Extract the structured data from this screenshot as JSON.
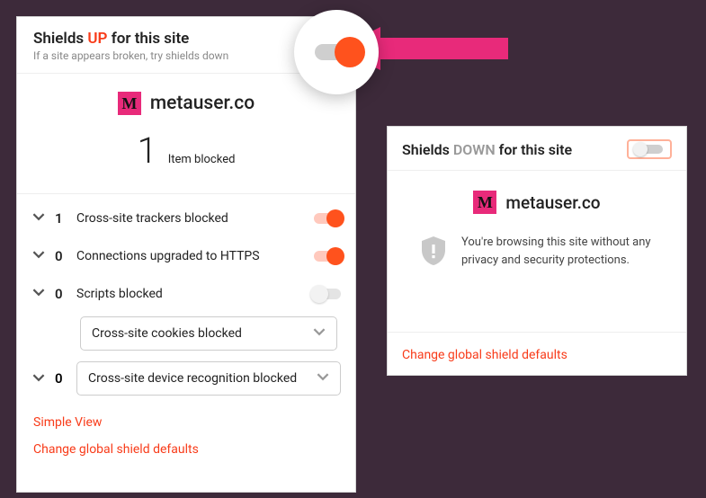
{
  "up": {
    "title_prefix": "Shields ",
    "title_accent": "UP",
    "title_suffix": " for this site",
    "subtitle": "If a site appears broken, try shields down",
    "site_name": "metauser.co",
    "blocked_count": "1",
    "blocked_label": "Item blocked",
    "rows": [
      {
        "count": "1",
        "label": "Cross-site trackers blocked"
      },
      {
        "count": "0",
        "label": "Connections upgraded to HTTPS"
      },
      {
        "count": "0",
        "label": "Scripts blocked"
      }
    ],
    "select_cookies": "Cross-site cookies blocked",
    "device_row_count": "0",
    "select_device": "Cross-site device recognition blocked",
    "link_simple": "Simple View",
    "link_global": "Change global shield defaults"
  },
  "down": {
    "title_prefix": "Shields ",
    "title_accent": "DOWN",
    "title_suffix": " for this site",
    "site_name": "metauser.co",
    "warn_text": "You're browsing this site without any privacy and security protections.",
    "link_global": "Change global shield defaults"
  }
}
